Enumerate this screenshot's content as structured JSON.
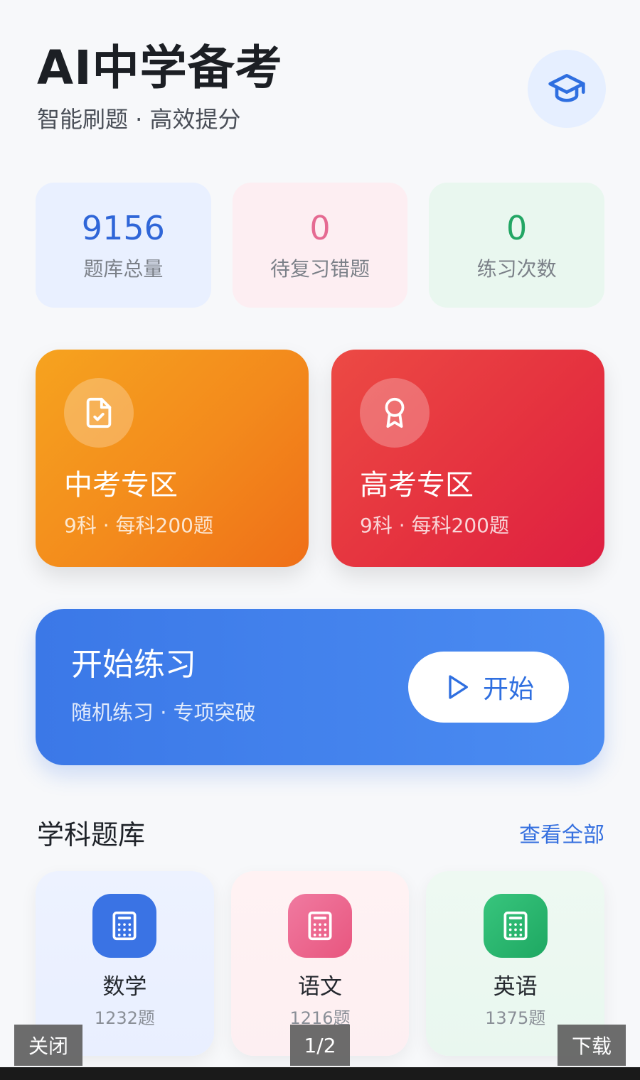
{
  "header": {
    "title": "AI中学备考",
    "subtitle": "智能刷题 · 高效提分",
    "badge_icon": "graduation-cap-icon"
  },
  "stats": [
    {
      "value": "9156",
      "label": "题库总量",
      "color": "#2f66d8"
    },
    {
      "value": "0",
      "label": "待复习错题",
      "color": "#e56a92"
    },
    {
      "value": "0",
      "label": "练习次数",
      "color": "#22a664"
    }
  ],
  "zones": [
    {
      "title": "中考专区",
      "desc": "9科 · 每科200题",
      "icon": "document-check-icon"
    },
    {
      "title": "高考专区",
      "desc": "9科 · 每科200题",
      "icon": "award-ribbon-icon"
    }
  ],
  "practice": {
    "title": "开始练习",
    "desc": "随机练习 · 专项突破",
    "button_label": "开始",
    "button_icon": "play-icon"
  },
  "subjects_section": {
    "title": "学科题库",
    "view_all": "查看全部"
  },
  "subjects": [
    {
      "name": "数学",
      "count": "1232题",
      "icon": "calculator-icon"
    },
    {
      "name": "语文",
      "count": "1216题",
      "icon": "calculator-icon"
    },
    {
      "name": "英语",
      "count": "1375题",
      "icon": "calculator-icon"
    }
  ],
  "viewer": {
    "close_label": "关闭",
    "page_indicator": "1/2",
    "download_label": "下载"
  }
}
